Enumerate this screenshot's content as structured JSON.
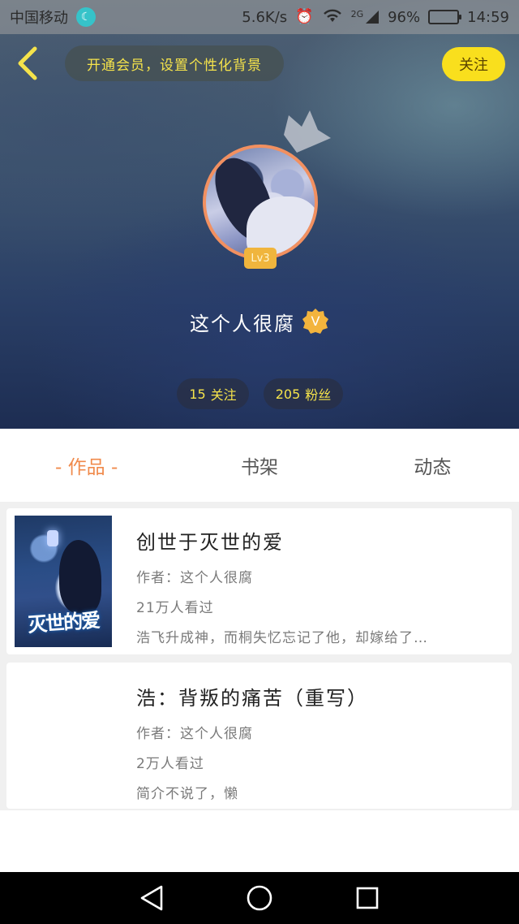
{
  "status_bar": {
    "carrier": "中国移动",
    "speed": "5.6K/s",
    "network": "2G",
    "battery": "96%",
    "battery_level": 0.96,
    "time": "14:59"
  },
  "header": {
    "vip_prompt": "开通会员，设置个性化背景",
    "follow_label": "关注"
  },
  "profile": {
    "level": "Lv3",
    "username": "这个人很腐",
    "verified_badge": "V",
    "following_count": "15",
    "following_label": "关注",
    "fans_count": "205",
    "fans_label": "粉丝"
  },
  "tabs": [
    {
      "label": "- 作品 -",
      "active": true
    },
    {
      "label": "书架",
      "active": false
    },
    {
      "label": "动态",
      "active": false
    }
  ],
  "works": [
    {
      "title": "创世于灭世的爱",
      "author": "作者：这个人很腐",
      "views": "21万人看过",
      "summary": "浩飞升成神，而桐失忆忘记了他，却嫁给了…",
      "cover_text": "灭世的爱"
    },
    {
      "title": "浩：背叛的痛苦（重写）",
      "author": "作者：这个人很腐",
      "views": "2万人看过",
      "summary": "简介不说了，懒"
    }
  ],
  "colors": {
    "accent_yellow": "#f9df1d",
    "tab_active": "#f08a4b",
    "avatar_ring": "#f29060"
  }
}
